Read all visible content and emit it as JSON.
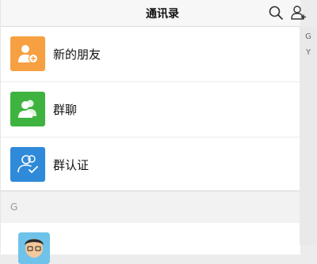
{
  "header": {
    "title": "通讯录",
    "search_icon": "search-icon",
    "add_contact_icon": "add-contact-icon"
  },
  "functions": [
    {
      "label": "新的朋友",
      "icon": "person-plus-icon",
      "color": "#f6a042"
    },
    {
      "label": "群聊",
      "icon": "group-icon",
      "color": "#3fb340"
    },
    {
      "label": "群认证",
      "icon": "group-verified-icon",
      "color": "#2f8ad9"
    }
  ],
  "section": {
    "letter": "G"
  },
  "contacts": [
    {
      "name": "",
      "avatar": "cartoon-avatar"
    }
  ],
  "index_bar": {
    "letters": [
      "G",
      "Y"
    ]
  }
}
